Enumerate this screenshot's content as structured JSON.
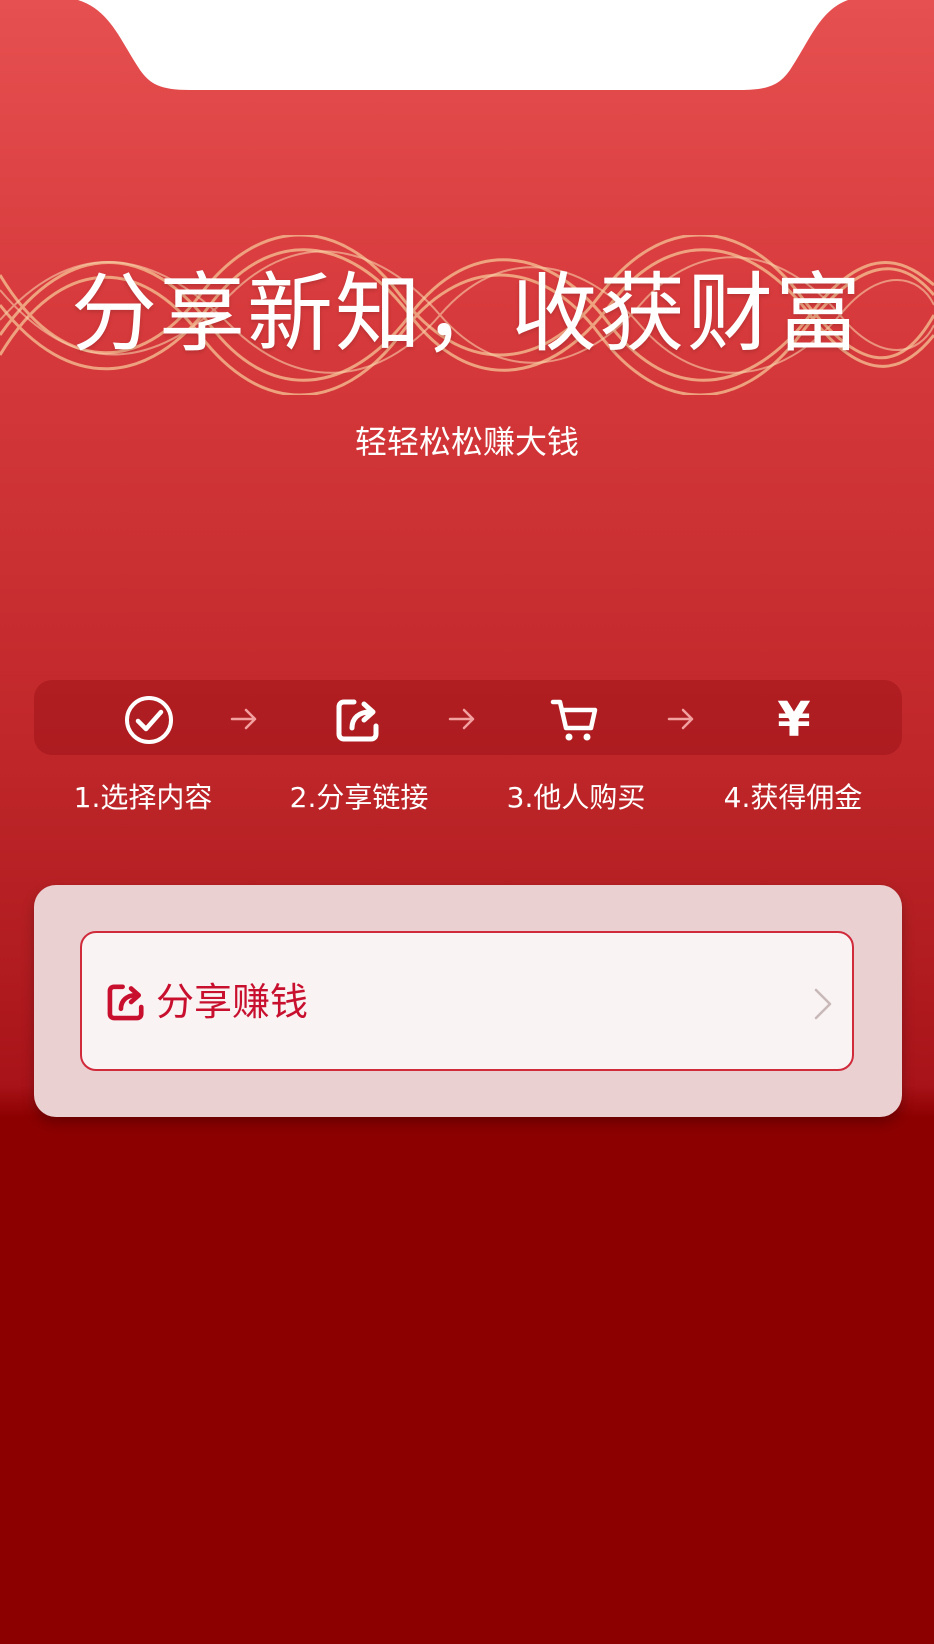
{
  "hero": {
    "title": "分享新知，收获财富",
    "subtitle": "轻轻松松赚大钱"
  },
  "steps": [
    {
      "label": "1.选择内容",
      "icon": "check-circle-icon"
    },
    {
      "label": "2.分享链接",
      "icon": "share-icon"
    },
    {
      "label": "3.他人购买",
      "icon": "cart-icon"
    },
    {
      "label": "4.获得佣金",
      "icon": "yen-icon",
      "glyph": "¥"
    }
  ],
  "share_button": {
    "label": "分享赚钱",
    "icon": "share-icon"
  },
  "colors": {
    "accent": "#c8102e",
    "background_top": "#e65050",
    "background_bottom": "#8c0000",
    "card": "#ead0d1",
    "button_fill": "#f9f3f3",
    "wave": "#f3b48a"
  }
}
